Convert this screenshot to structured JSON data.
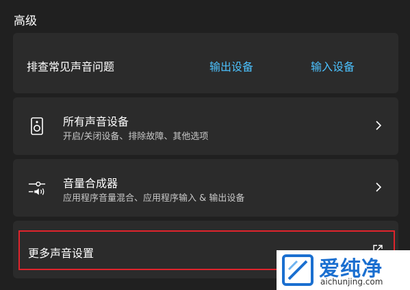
{
  "section": {
    "title": "高级"
  },
  "troubleshoot": {
    "label": "排查常见声音问题",
    "output_link": "输出设备",
    "input_link": "输入设备"
  },
  "all_devices": {
    "icon": "speaker-icon",
    "title": "所有声音设备",
    "subtitle": "开启/关闭设备、排除故障、其他选项"
  },
  "mixer": {
    "icon": "volume-mixer-icon",
    "title": "音量合成器",
    "subtitle": "应用程序音量混合、应用程序输入 & 输出设备"
  },
  "more_settings": {
    "label": "更多声音设置",
    "icon": "external-link-icon"
  },
  "watermark": {
    "brand": "爱纯净",
    "url": "aichunjing.com"
  },
  "colors": {
    "background": "#202020",
    "card": "#2b2b2b",
    "link": "#4cc2ff",
    "highlight": "#e0242c"
  }
}
